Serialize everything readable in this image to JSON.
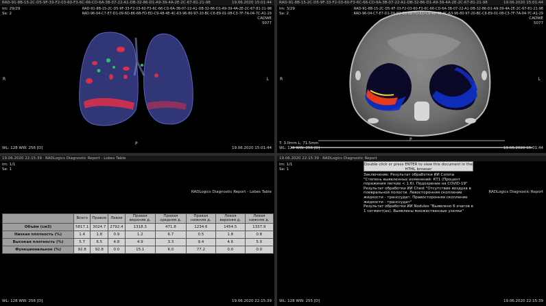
{
  "viewports": {
    "tl": {
      "topbar_id": "RAD-91-8B-15-2C-D5-9F-33-F2-03-60-F3-6C-66-CD-6A-3B-07-22-A1-DB-32-86-D1-A9-39-4A-2E-2C-67-81-21-98",
      "topbar_date": "19.06.2020 15:01:44",
      "im": "Im: 29/29",
      "se": "Se: 2",
      "id1": "RAD-91-8B-15-2C-D5-9F-33-F2-03-60-F3-6C-66-CD-6A-3B-07-22-A1-DB-32-86-D1-A9-39-4A-2E-2C-67-81-21-98",
      "id2": "RAD-96-04-C7-E7-D1-09-6D-86-6B-FD-ED-C9-48-4E-4C-63-96-80-97-20-BC-C6-E9-01-08-C3-7F-7A-04-7C-A1-29",
      "corner_lines": [
        "CADWE",
        "5077"
      ],
      "orient_left": "R",
      "orient_right": "L",
      "orient_bottom": "P",
      "wl": "WL: 128 WW: 256 [D]",
      "date_bottom": "19.06.2020 15:01:44"
    },
    "tr": {
      "topbar_id": "RAD-91-8B-15-2C-D5-9F-33-F2-03-60-F3-6C-66-CD-6A-3B-07-22-A1-DB-32-86-D1-A9-39-4A-2E-2C-67-81-21-98",
      "topbar_date": "19.06.2020 15:01:44",
      "im": "Im: 3/29",
      "se": "Se: 2",
      "id1": "RAD-91-8B-15-2C-D5-9F-33-F2-03-60-F3-6C-66-CD-6A-3B-07-22-A1-DB-32-86-D1-A9-39-4A-2E-2C-67-81-21-98",
      "id2": "RAD-96-04-C7-E7-D1-09-6D-86-6B-FD-ED-C9-48-4E-4C-63-96-80-97-20-BC-C6-E9-01-08-C3-7F-7A-04-7C-A1-29",
      "corner_lines": [
        "CADWE",
        "5077"
      ],
      "orient_left": "R",
      "orient_right": "L",
      "orient_bottom": "P",
      "thickness": "T: 3.0mm L: 71.5mm",
      "wl": "WL: 128 WW: 256 [D]",
      "date_bottom": "19.06.2020 15:01:44"
    },
    "bl": {
      "topbar_text": "19.06.2020 22:15:39 · RADLogics Diagnostic Report - Lobes Table",
      "im": "Im: 1/1",
      "se": "Se: 1",
      "report_title": "RADLogics Diagnostic Report - Lobes Table",
      "wl": "WL: 128 WW: 256 [D]",
      "date_bottom": "19.06.2020 22:15:39",
      "table": {
        "headers": [
          "Всего",
          "Правое",
          "Левое",
          "Правая верхняя д.",
          "Правая средняя д.",
          "Правая нижняя д.",
          "Левая верхняя д.",
          "Левая нижняя д."
        ],
        "rows": [
          {
            "label": "Объём (см3)",
            "values": [
              "5817.1",
              "3024.7",
              "2792.4",
              "1318.3",
              "471.8",
              "1234.6",
              "1454.5",
              "1337.9"
            ]
          },
          {
            "label": "Низкая плотность (%)",
            "values": [
              "1.4",
              "1.8",
              "0.9",
              "1.2",
              "6.7",
              "0.5",
              "1.8",
              "0.8"
            ]
          },
          {
            "label": "Высокая плотность (%)",
            "values": [
              "5.7",
              "6.5",
              "4.8",
              "4.9",
              "3.3",
              "9.4",
              "4.6",
              "5.0"
            ]
          },
          {
            "label": "Функциональное (%)",
            "values": [
              "92.8",
              "92.8",
              "0.0",
              "15.1",
              "6.0",
              "77.2",
              "0.0",
              "0.0"
            ]
          }
        ]
      }
    },
    "br": {
      "topbar_text": "19.06.2020 22:15:39 · RADLogics Diagnostic Report",
      "im": "Im: 1/1",
      "se": "Se: 1",
      "browser_btn": "Double click or press ENTER to view this document in the HTML browser",
      "report_title": "RADLogics Diagnostic Report",
      "conclusion": "Заключение: Результат обработки ИИ Corona \"Степень выявленных изменений: КТ1 (Процент поражения легких < 1.6). Подозрение на COVID-19\"\nРезультат обработки ИИ Chest \"Отсутствие воздуха в плевральной полости. Левосторонняя скопление жидкости - транссудат. Правосторонняя скопление жидкости - транссудат\"\nРезультат обработки ИИ Nodules \"Выявлено 6 очагов в 1 сегмент(ах). Выявлены множественные узелки\"",
      "wl": "WL: 128 WW: 255 [D]",
      "date_bottom": "19.06.2020 22:15:39"
    }
  },
  "colors": {
    "background": "#000000",
    "divider": "#2c2c2c",
    "lung_volume": "#3a3f8c",
    "lesion_red": "#d8304a",
    "lesion_green": "#2fbf6a",
    "overlay_blue": "#1030c8",
    "overlay_red": "#e83a1a"
  }
}
